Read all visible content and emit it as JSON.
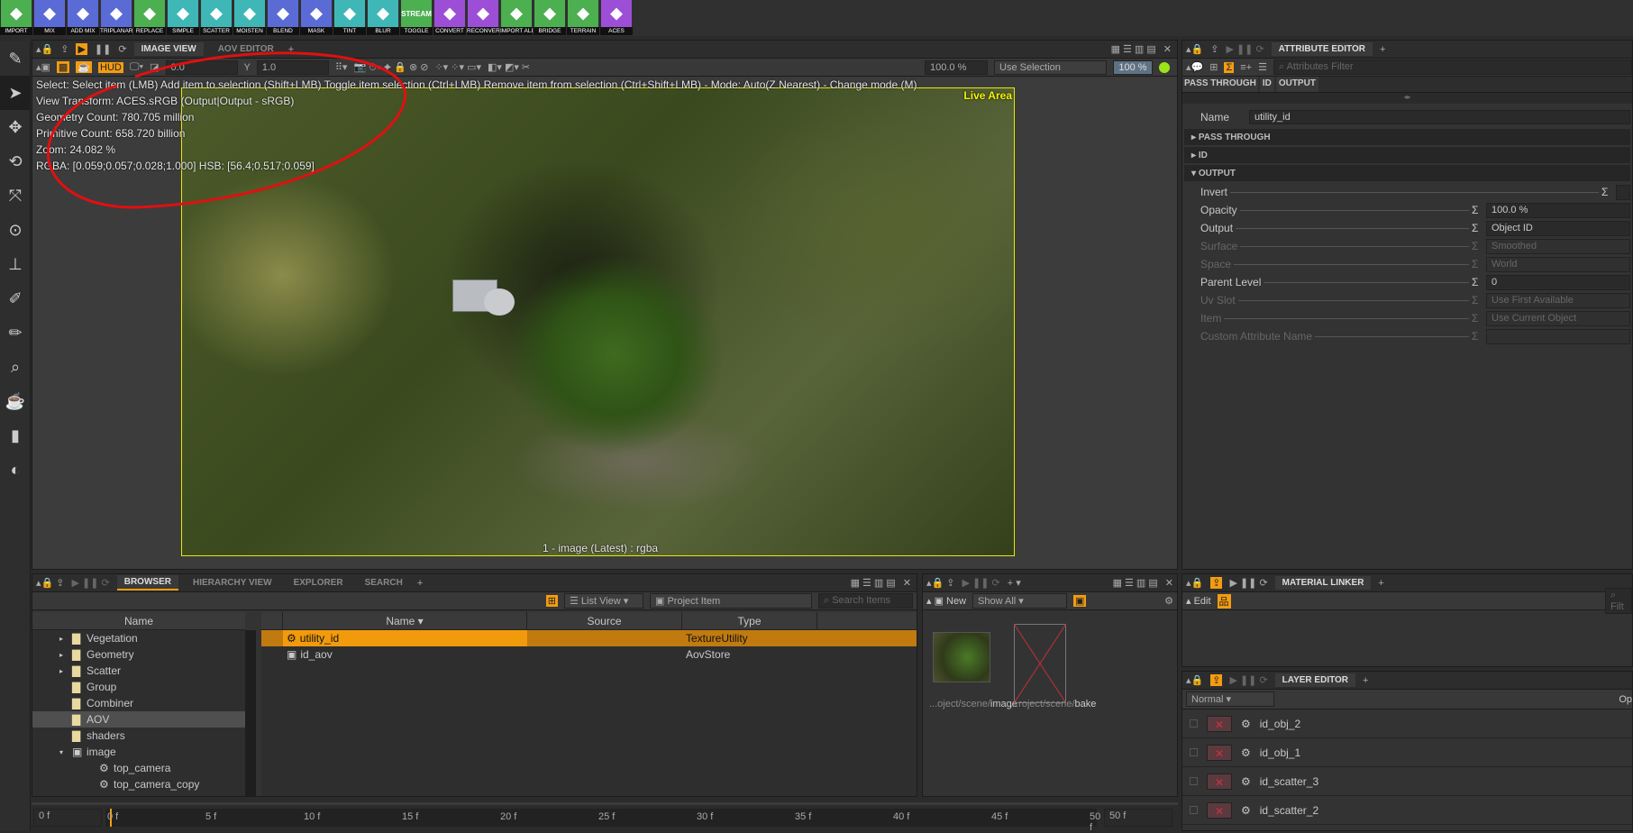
{
  "toolbar": {
    "buttons": [
      {
        "label": "IMPORT",
        "color": "#4caf50",
        "icon": "download-icon"
      },
      {
        "label": "MIX",
        "color": "#5b6bd6",
        "icon": "layers-plus-icon"
      },
      {
        "label": "ADD MIX",
        "color": "#5b6bd6",
        "icon": "layers-add-icon"
      },
      {
        "label": "TRIPLANAR",
        "color": "#5b6bd6",
        "icon": "hierarchy-icon"
      },
      {
        "label": "REPLACE",
        "color": "#4caf50",
        "icon": "replace-icon"
      },
      {
        "label": "SIMPLE",
        "color": "#3fb7b7",
        "icon": "gauge-icon"
      },
      {
        "label": "SCATTER",
        "color": "#3fb7b7",
        "icon": "scatter-icon"
      },
      {
        "label": "MOISTEN",
        "color": "#3fb7b7",
        "icon": "cloud-rain-icon"
      },
      {
        "label": "BLEND",
        "color": "#5b6bd6",
        "icon": "blend-icon"
      },
      {
        "label": "MASK",
        "color": "#5b6bd6",
        "icon": "mask-icon"
      },
      {
        "label": "TINT",
        "color": "#3fb7b7",
        "icon": "brush-icon"
      },
      {
        "label": "BLUR",
        "color": "#3fb7b7",
        "icon": "drop-icon"
      },
      {
        "label": "TOGGLE",
        "color": "#4caf50",
        "icon": "stream-icon",
        "text": "STREAM"
      },
      {
        "label": "CONVERT",
        "color": "#9c4fd6",
        "icon": "convert-icon"
      },
      {
        "label": "RECONVERT",
        "color": "#9c4fd6",
        "icon": "reconvert-icon"
      },
      {
        "label": "IMPORT ALL",
        "color": "#4caf50",
        "icon": "import-all-icon"
      },
      {
        "label": "BRIDGE",
        "color": "#4caf50",
        "icon": "bridge-icon"
      },
      {
        "label": "TERRAIN",
        "color": "#4caf50",
        "icon": "mountain-icon"
      },
      {
        "label": "ACES",
        "color": "#9c4fd6",
        "icon": "aces-icon"
      }
    ]
  },
  "image_view": {
    "tabs": [
      "IMAGE VIEW",
      "AOV EDITOR"
    ],
    "exposure": "0.0",
    "gamma": "1.0",
    "zoom_field": "100.0 %",
    "selection_mode": "Use Selection",
    "scale": "100 %",
    "overlay": [
      "Select: Select item (LMB)  Add item to selection (Shift+LMB)  Toggle item selection (Ctrl+LMB)  Remove item from selection (Ctrl+Shift+LMB)  - Mode: Auto(Z Nearest) - Change mode (M)",
      "View Transform: ACES.sRGB (Output|Output - sRGB)",
      "Geometry Count: 780.705 million",
      "Primitive Count: 658.720 billion",
      "Zoom: 24.082 %",
      "RGBA: [0.059;0.057;0.028;1.000] HSB: [56.4;0.517;0.059]"
    ],
    "live_area": "Live Area",
    "caption": "1 - image (Latest) : rgba",
    "status_color": "#9be31a"
  },
  "attribute_editor": {
    "title": "ATTRIBUTE EDITOR",
    "filter_placeholder": "Attributes Filter",
    "quick_tabs": [
      "PASS THROUGH",
      "ID",
      "OUTPUT"
    ],
    "name_label": "Name",
    "name_value": "utility_id",
    "sections": [
      "PASS THROUGH",
      "ID",
      "OUTPUT"
    ],
    "attributes": [
      {
        "label": "Invert",
        "value": "",
        "enabled": true
      },
      {
        "label": "Opacity",
        "value": "100.0 %",
        "enabled": true
      },
      {
        "label": "Output",
        "value": "Object ID",
        "enabled": true
      },
      {
        "label": "Surface",
        "value": "Smoothed",
        "enabled": false
      },
      {
        "label": "Space",
        "value": "World",
        "enabled": false
      },
      {
        "label": "Parent Level",
        "value": "0",
        "enabled": true
      },
      {
        "label": "Uv Slot",
        "value": "Use First Available",
        "enabled": false
      },
      {
        "label": "Item",
        "value": "Use Current Object",
        "enabled": false
      },
      {
        "label": "Custom Attribute Name",
        "value": "",
        "enabled": false
      }
    ]
  },
  "browser": {
    "tabs": [
      "BROWSER",
      "HIERARCHY VIEW",
      "EXPLORER",
      "SEARCH"
    ],
    "view_mode": "List View",
    "filter": "Project Item",
    "search_placeholder": "Search Items",
    "tree_header": "Name",
    "tree": [
      {
        "label": "Vegetation",
        "indent": 1,
        "expander": "right",
        "kind": "folder"
      },
      {
        "label": "Geometry",
        "indent": 1,
        "expander": "right",
        "kind": "folder"
      },
      {
        "label": "Scatter",
        "indent": 1,
        "expander": "right",
        "kind": "folder"
      },
      {
        "label": "Group",
        "indent": 1,
        "kind": "folder"
      },
      {
        "label": "Combiner",
        "indent": 1,
        "kind": "folder"
      },
      {
        "label": "AOV",
        "indent": 1,
        "kind": "folder",
        "selected": true
      },
      {
        "label": "shaders",
        "indent": 1,
        "kind": "folder"
      },
      {
        "label": "image",
        "indent": 1,
        "expander": "down",
        "kind": "image"
      },
      {
        "label": "top_camera",
        "indent": 2,
        "kind": "camera"
      },
      {
        "label": "top_camera_copy",
        "indent": 2,
        "kind": "camera"
      }
    ],
    "columns": [
      "Name",
      "Source",
      "Type"
    ],
    "rows": [
      {
        "name": "utility_id",
        "source": "",
        "type": "TextureUtility",
        "selected": true
      },
      {
        "name": "id_aov",
        "source": "",
        "type": "AovStore"
      }
    ]
  },
  "thumbnails": {
    "new_label": "New",
    "filter": "Show All",
    "items": [
      {
        "prefix": "...oject/scene/",
        "name": "image"
      },
      {
        "prefix": "...roject/scene/",
        "name": "bake"
      }
    ]
  },
  "material_linker": {
    "title": "MATERIAL LINKER",
    "edit_label": "Edit",
    "filter_placeholder": "Filt"
  },
  "layer_editor": {
    "title": "LAYER EDITOR",
    "blend_mode": "Normal",
    "opacity_label": "Op",
    "layers": [
      "id_obj_2",
      "id_obj_1",
      "id_scatter_3",
      "id_scatter_2"
    ]
  },
  "timeline": {
    "start": "0 f",
    "end": "50 f",
    "ticks": [
      "0 f",
      "5 f",
      "10 f",
      "15 f",
      "20 f",
      "25 f",
      "30 f",
      "35 f",
      "40 f",
      "45 f",
      "50 f"
    ]
  },
  "colors": {
    "accent": "#f39c12",
    "selection": "#f09a0c",
    "annotation": "#e01010"
  }
}
